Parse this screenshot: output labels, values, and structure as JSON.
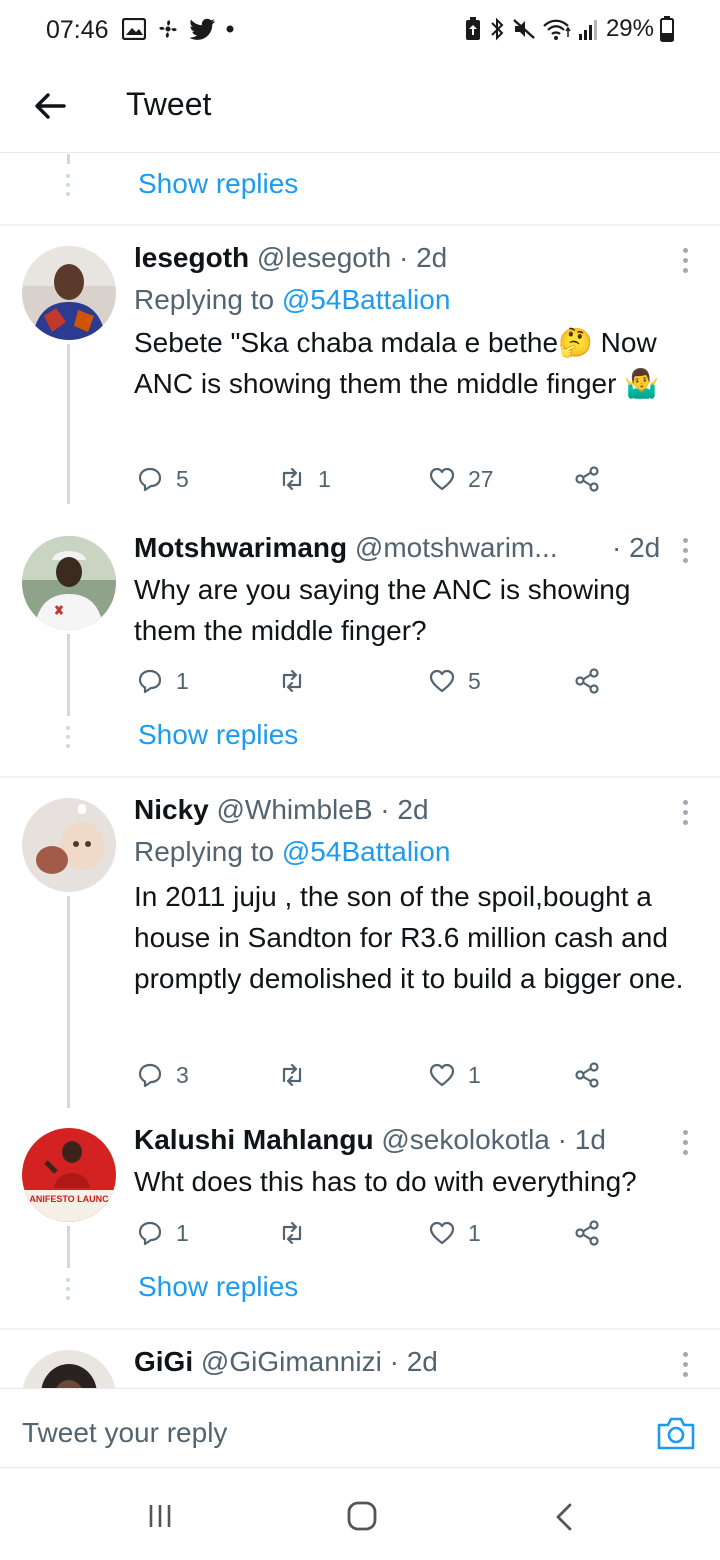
{
  "status_bar": {
    "time": "07:46",
    "battery": "29%"
  },
  "header": {
    "title": "Tweet"
  },
  "show_replies_label": "Show replies",
  "tweets": [
    {
      "name": "lesegoth",
      "handle": "@lesegoth",
      "time": "· 2d",
      "replying_prefix": "Replying to ",
      "replying_to": "@54Battalion",
      "text": "Sebete \"Ska chaba mdala e bethe🤔 Now ANC is showing them the middle finger 🤷‍♂️",
      "replies": "5",
      "retweets": "1",
      "likes": "27"
    },
    {
      "name": "Motshwarimang",
      "handle": "@motshwarim...",
      "time": "· 2d",
      "text": "Why are you saying the ANC is showing them the middle finger?",
      "replies": "1",
      "retweets": "",
      "likes": "5"
    },
    {
      "name": "Nicky",
      "handle": "@WhimbleB",
      "time": "· 2d",
      "replying_prefix": "Replying to ",
      "replying_to": "@54Battalion",
      "text": "In 2011 juju , the son of the spoil,bought a house in Sandton for R3.6 million cash and promptly demolished it to build a bigger one.",
      "replies": "3",
      "retweets": "",
      "likes": "1"
    },
    {
      "name": "Kalushi Mahlangu",
      "handle": "@sekolokotla",
      "time": "· 1d",
      "text": "Wht does this has to do with everything?",
      "replies": "1",
      "retweets": "",
      "likes": "1",
      "avatar_text": "ANIFESTO LAUNC"
    },
    {
      "name": "GiGi",
      "handle": "@GiGimannizi",
      "time": "· 2d"
    }
  ],
  "reply_bar": {
    "placeholder": "Tweet your reply"
  },
  "colors": {
    "accent": "#1d9bf0",
    "secondary_text": "#536471",
    "thread_line": "#cfd9de"
  }
}
